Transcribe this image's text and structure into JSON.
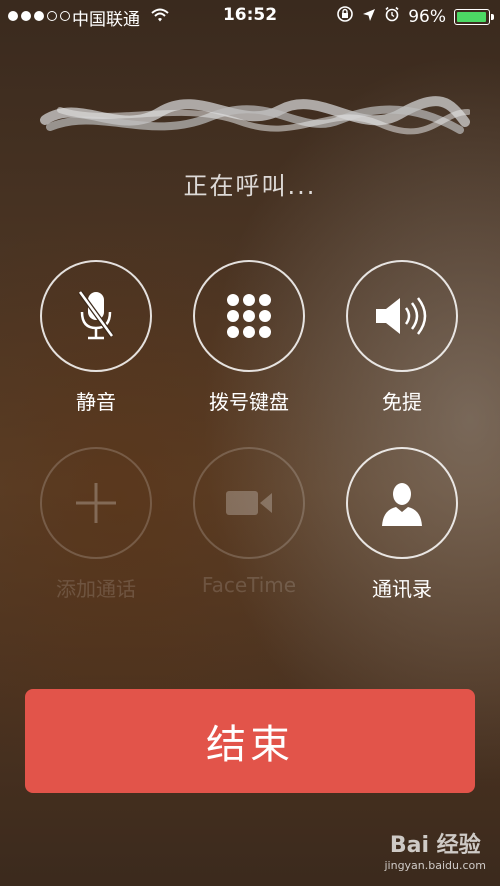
{
  "status_bar": {
    "carrier": "中国联通",
    "time": "16:52",
    "battery_percent": "96%",
    "battery_level": 0.96,
    "signal_bars_filled": 3,
    "signal_bars_total": 5
  },
  "call": {
    "status": "正在呼叫..."
  },
  "buttons": {
    "mute": "静音",
    "keypad": "拨号键盘",
    "speaker": "免提",
    "add_call": "添加通话",
    "facetime": "FaceTime",
    "contacts": "通讯录"
  },
  "end_button": "结束",
  "watermark": {
    "brand": "Bai 经验",
    "url": "jingyan.baidu.com"
  },
  "colors": {
    "end_button": "#e2544a",
    "battery": "#4cd964"
  }
}
